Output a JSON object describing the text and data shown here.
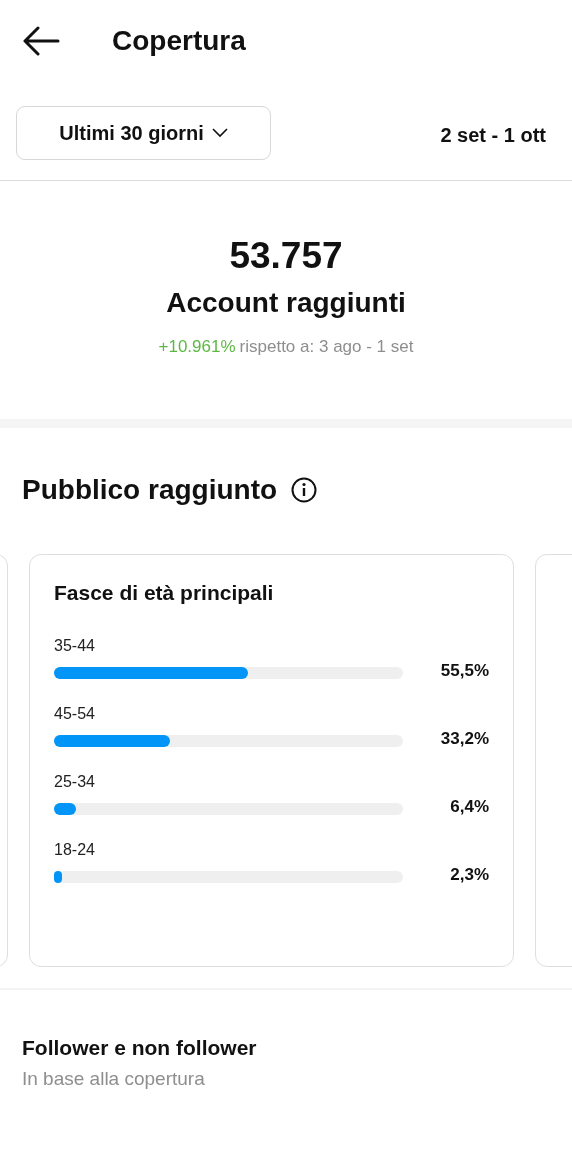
{
  "header": {
    "title": "Copertura"
  },
  "filter": {
    "period": "Ultimi 30 giorni",
    "date_range": "2 set - 1 ott"
  },
  "summary": {
    "value": "53.757",
    "label": "Account raggiunti",
    "change": "+10.961%",
    "comparison": "rispetto a: 3 ago - 1 set"
  },
  "audience": {
    "title": "Pubblico raggiunto",
    "card": {
      "title": "Fasce di età principali",
      "rows": [
        {
          "label": "35-44",
          "level": 0.555,
          "value": "55,5%"
        },
        {
          "label": "45-54",
          "level": 0.332,
          "value": "33,2%"
        },
        {
          "label": "25-34",
          "level": 0.064,
          "value": "6,4%"
        },
        {
          "label": "18-24",
          "level": 0.023,
          "value": "2,3%"
        }
      ]
    }
  },
  "followers": {
    "title": "Follower e non follower",
    "subtitle": "In base alla copertura"
  }
}
